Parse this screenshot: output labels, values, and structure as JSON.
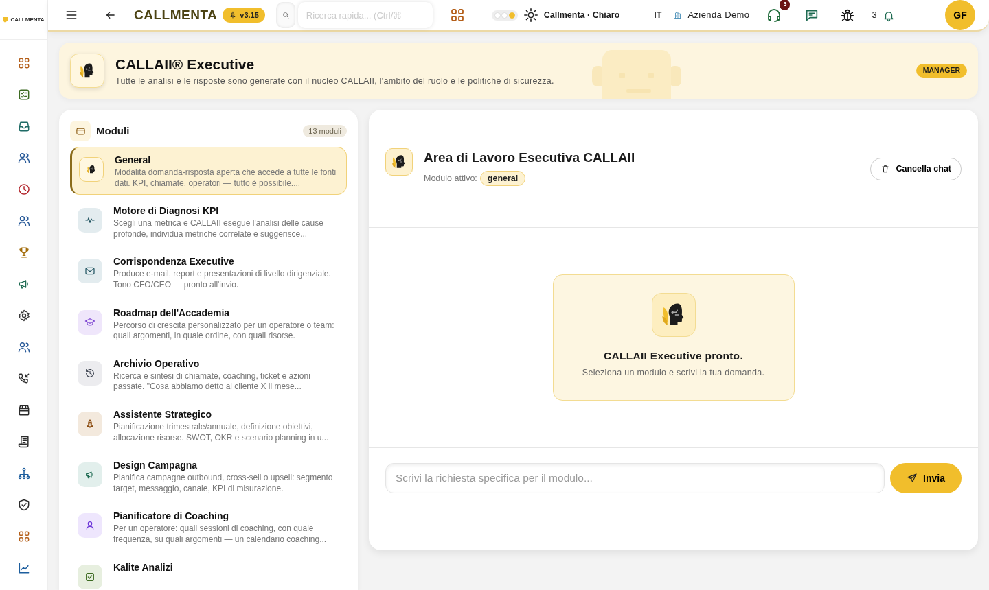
{
  "rail": {
    "logo": "CALLMENTA",
    "items": [
      {
        "kind": "grid"
      },
      {
        "kind": "checklist"
      },
      {
        "kind": "inbox"
      },
      {
        "kind": "users"
      },
      {
        "kind": "clock"
      },
      {
        "kind": "users"
      },
      {
        "kind": "trophy"
      },
      {
        "kind": "megaphone"
      },
      {
        "kind": "gear"
      },
      {
        "kind": "users"
      },
      {
        "kind": "phone"
      },
      {
        "kind": "store"
      },
      {
        "kind": "receipt"
      },
      {
        "kind": "hierarchy"
      },
      {
        "kind": "shield"
      },
      {
        "kind": "grid"
      },
      {
        "kind": "chart"
      }
    ]
  },
  "topbar": {
    "brand": "CALLMENTA",
    "version": "v3.15",
    "search": {
      "placeholder": "Ricerca rapida... (Ctrl/⌘"
    },
    "theme_options": [
      {
        "selected": false
      },
      {
        "selected": false
      },
      {
        "selected": true
      }
    ],
    "theme_label": "Callmenta · Chiaro",
    "language": "IT",
    "company": "Azienda Demo",
    "chat_badge": "3",
    "notification_count": "3",
    "avatar": "GF"
  },
  "banner": {
    "title": "CALLAII® Executive",
    "subtitle": "Tutte le analisi e le risposte sono generate con il nucleo CALLAII, l'ambito del ruolo e le politiche di sicurezza.",
    "role": "MANAGER"
  },
  "modules": {
    "title": "Moduli",
    "count": "13 moduli",
    "items": [
      {
        "title": "General",
        "description": "Modalità domanda-risposta aperta che accede a tutte le fonti dati. KPI, chiamate, operatori — tutto è possibile....",
        "kind": "head",
        "selected": true
      },
      {
        "title": "Motore di Diagnosi KPI",
        "description": "Scegli una metrica e CALLAII esegue l'analisi delle cause profonde, individua metriche correlate e suggerisce...",
        "kind": "pulse",
        "selected": false
      },
      {
        "title": "Corrispondenza Executive",
        "description": "Produce e-mail, report e presentazioni di livello dirigenziale. Tono CFO/CEO — pronto all'invio.",
        "kind": "mail",
        "selected": false
      },
      {
        "title": "Roadmap dell'Accademia",
        "description": "Percorso di crescita personalizzato per un operatore o team: quali argomenti, in quale ordine, con quali risorse.",
        "kind": "cap",
        "selected": false
      },
      {
        "title": "Archivio Operativo",
        "description": "Ricerca e sintesi di chiamate, coaching, ticket e azioni passate. \"Cosa abbiamo detto al cliente X il mese...",
        "kind": "history",
        "selected": false
      },
      {
        "title": "Assistente Strategico",
        "description": "Pianificazione trimestrale/annuale, definizione obiettivi, allocazione risorse. SWOT, OKR e scenario planning in u...",
        "kind": "rocket",
        "selected": false
      },
      {
        "title": "Design Campagna",
        "description": "Pianifica campagne outbound, cross-sell o upsell: segmento target, messaggio, canale, KPI di misurazione.",
        "kind": "megaphone",
        "selected": false
      },
      {
        "title": "Pianificatore di Coaching",
        "description": "Per un operatore: quali sessioni di coaching, con quale frequenza, su quali argomenti — un calendario coaching...",
        "kind": "user",
        "selected": false
      },
      {
        "title": "Kalite Analizi",
        "kind": "check",
        "selected": false
      }
    ]
  },
  "workspace": {
    "title": "Area di Lavoro Esecutiva CALLAII",
    "active_label": "Modulo attivo:",
    "active_module": "general",
    "clear_button": "Cancella chat",
    "empty_title": "CALLAII Executive pronto.",
    "empty_text": "Seleziona un modulo e scrivi la tua domanda.",
    "input": {
      "placeholder": "Scrivi la richiesta specifica per il modulo..."
    },
    "send_button": "Invia"
  }
}
